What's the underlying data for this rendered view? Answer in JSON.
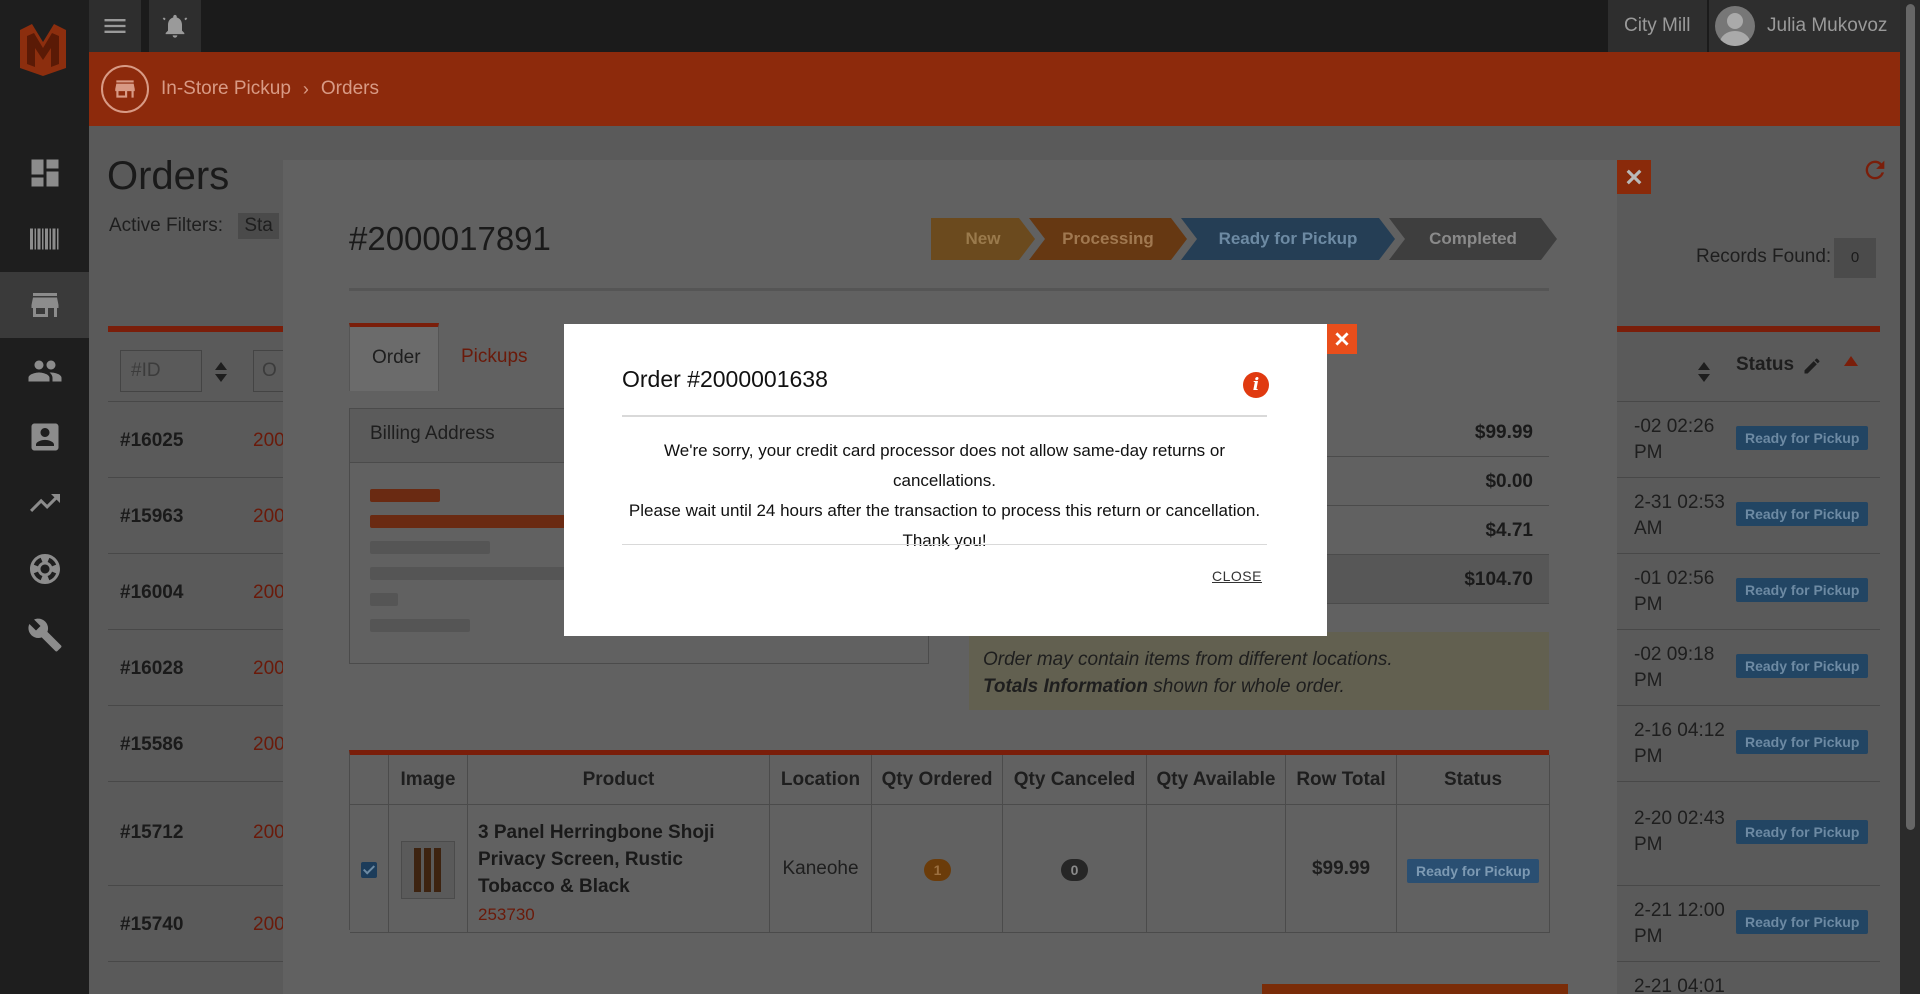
{
  "colors": {
    "brand": "#e94e1b",
    "step_new": "#c5760d",
    "step_processing": "#b75e0c",
    "step_ready": "#2d5f8a",
    "step_completed": "#515151",
    "badge_blue": "#224563"
  },
  "sidebar": {
    "items": [
      {
        "icon": "dashboard-icon"
      },
      {
        "icon": "barcode-icon"
      },
      {
        "icon": "store-icon",
        "active": true
      },
      {
        "icon": "customers-icon"
      },
      {
        "icon": "contact-card-icon"
      },
      {
        "icon": "trending-up-icon"
      },
      {
        "icon": "support-icon"
      },
      {
        "icon": "wrench-icon"
      }
    ]
  },
  "topbar": {
    "store": "City Mill",
    "user": "Julia Mukovoz"
  },
  "breadcrumb": {
    "items": [
      "In-Store Pickup",
      "Orders"
    ]
  },
  "page": {
    "title": "Orders",
    "active_filters_label": "Active Filters:",
    "filter_chip": "Sta",
    "records_label": "Records Found:",
    "records_count": "0",
    "id_filter_placeholder": "#ID",
    "order_filter_placeholder": "O",
    "status_header": "Status",
    "rows": [
      {
        "id": "#16025",
        "order": "200",
        "date": "-02 02:26",
        "ampm": "PM",
        "status": "Ready for Pickup"
      },
      {
        "id": "#15963",
        "order": "200",
        "date": "2-31 02:53",
        "ampm": "AM",
        "status": "Ready for Pickup"
      },
      {
        "id": "#16004",
        "order": "200",
        "date": "-01 02:56",
        "ampm": "PM",
        "status": "Ready for Pickup"
      },
      {
        "id": "#16028",
        "order": "200",
        "date": "-02 09:18",
        "ampm": "PM",
        "status": "Ready for Pickup"
      },
      {
        "id": "#15586",
        "order": "200",
        "date": "2-16 04:12",
        "ampm": "PM",
        "status": "Ready for Pickup"
      },
      {
        "id": "#15712",
        "order": "200",
        "date": "2-20 02:43",
        "ampm": "PM",
        "status": "Ready for Pickup"
      },
      {
        "id": "#15740",
        "order": "200",
        "date": "2-21 12:00",
        "ampm": "PM",
        "status": "Ready for Pickup"
      },
      {
        "id": "",
        "order": "",
        "date": "2-21 04:01",
        "ampm": "",
        "status": ""
      }
    ]
  },
  "order_modal": {
    "order_id": "#2000017891",
    "steps": [
      "New",
      "Processing",
      "Ready for Pickup",
      "Completed"
    ],
    "tabs": [
      "Order",
      "Pickups"
    ],
    "billing_header": "Billing Address",
    "totals": [
      "$99.99",
      "$0.00",
      "$4.71",
      "$104.70"
    ],
    "note_line1": "Order may contain items from different locations.",
    "note_bold": "Totals Information",
    "note_rest": " shown for whole order.",
    "table": {
      "headers": [
        "Image",
        "Product",
        "Location",
        "Qty Ordered",
        "Qty Canceled",
        "Qty Available",
        "Row Total",
        "Status"
      ],
      "row": {
        "product": "3 Panel Herringbone Shoji Privacy Screen, Rustic Tobacco & Black",
        "sku": "253730",
        "location": "Kaneohe",
        "qty_ordered": "1",
        "qty_canceled": "0",
        "qty_available": "",
        "row_total": "$99.99",
        "status": "Ready for Pickup"
      }
    }
  },
  "dialog": {
    "title": "Order #2000001638",
    "line1": "We're sorry, your credit card processor does not allow same-day returns or cancellations.",
    "line2": "Please wait until 24 hours after the transaction to process this return or cancellation.",
    "line3": "Thank you!",
    "close_label": "CLOSE"
  }
}
